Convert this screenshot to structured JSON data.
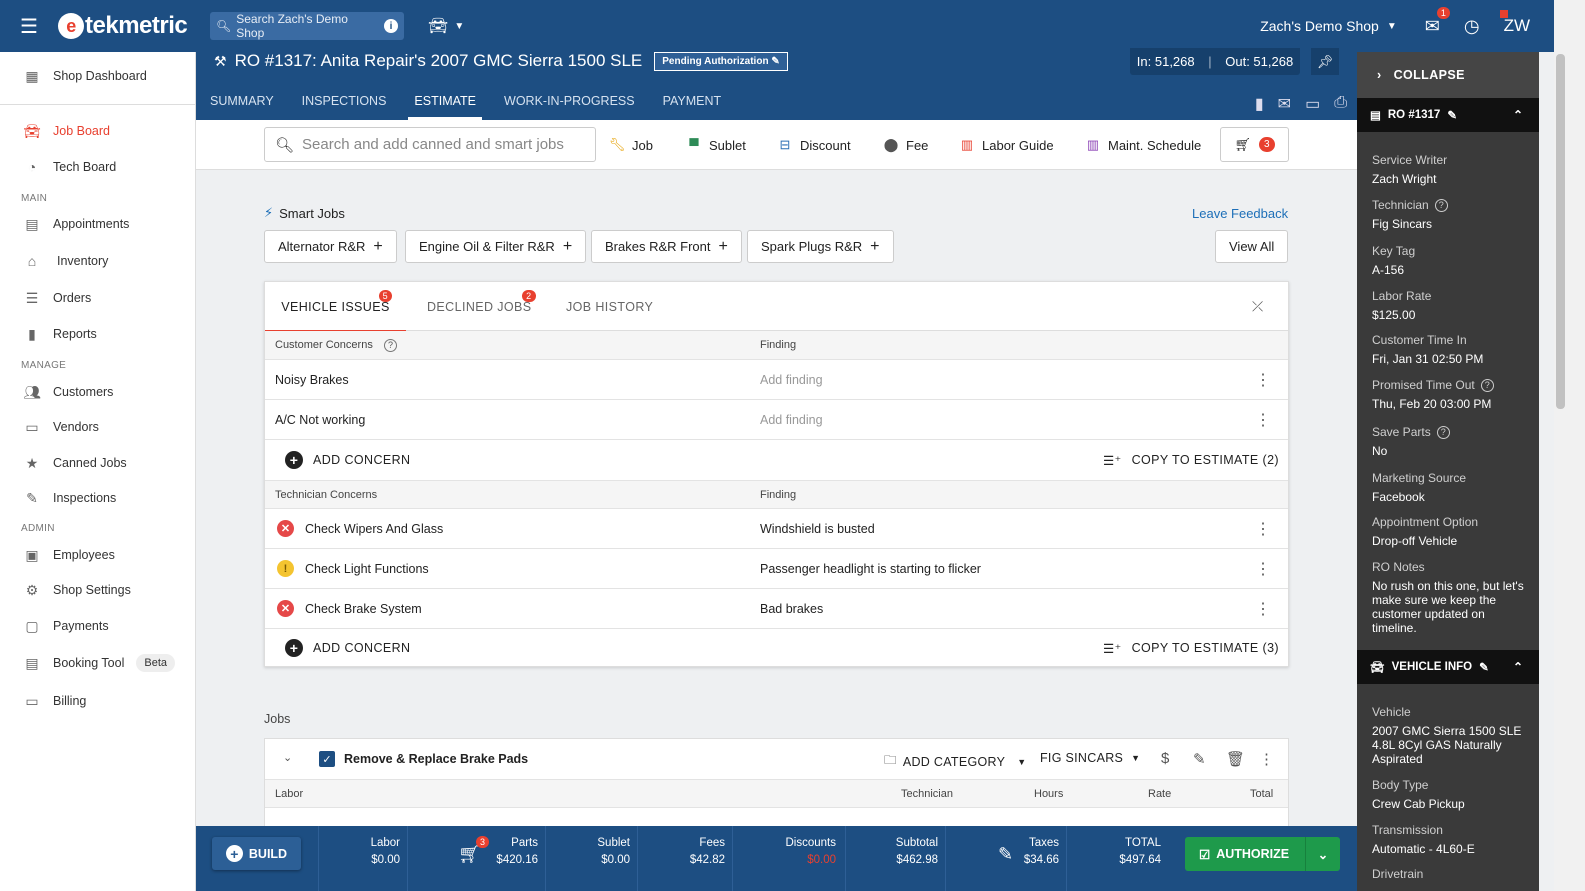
{
  "topbar": {
    "logo": "tekmetric",
    "logo_mark": "e",
    "search_placeholder": "Search Zach's Demo Shop",
    "shop_name": "Zach's Demo Shop",
    "messages_badge": "1",
    "user_initials": "ZW"
  },
  "sidebar": {
    "items": [
      {
        "label": "Shop Dashboard",
        "icon": "dashboard-icon"
      },
      {
        "label": "Job Board",
        "icon": "car-icon"
      },
      {
        "label": "Tech Board",
        "icon": "gauge-icon"
      },
      {
        "label": "Appointments",
        "icon": "calendar-icon"
      },
      {
        "label": "Inventory",
        "icon": "warehouse-icon"
      },
      {
        "label": "Orders",
        "icon": "list-icon"
      },
      {
        "label": "Reports",
        "icon": "bar-chart-icon"
      },
      {
        "label": "Customers",
        "icon": "people-icon"
      },
      {
        "label": "Vendors",
        "icon": "store-icon"
      },
      {
        "label": "Canned Jobs",
        "icon": "star-icon"
      },
      {
        "label": "Inspections",
        "icon": "clipboard-icon"
      },
      {
        "label": "Employees",
        "icon": "badge-icon"
      },
      {
        "label": "Shop Settings",
        "icon": "gear-icon"
      },
      {
        "label": "Payments",
        "icon": "payment-icon"
      },
      {
        "label": "Booking Tool",
        "icon": "booking-icon",
        "badge": "Beta"
      },
      {
        "label": "Billing",
        "icon": "credit-card-icon"
      }
    ],
    "sections": {
      "main": "MAIN",
      "manage": "MANAGE",
      "admin": "ADMIN"
    }
  },
  "ro": {
    "title": "RO #1317: Anita Repair's 2007 GMC Sierra 1500 SLE",
    "status": "Pending Authorization",
    "mileage_in": "In: 51,268",
    "mileage_out": "Out: 51,268",
    "tabs": [
      "SUMMARY",
      "INSPECTIONS",
      "ESTIMATE",
      "WORK-IN-PROGRESS",
      "PAYMENT"
    ]
  },
  "toolbar": {
    "search_placeholder": "Search and add canned and smart jobs",
    "buttons": [
      "Job",
      "Sublet",
      "Discount",
      "Fee",
      "Labor Guide",
      "Maint. Schedule"
    ],
    "cart_count": "3"
  },
  "smart_jobs": {
    "title": "Smart Jobs",
    "feedback": "Leave Feedback",
    "chips": [
      "Alternator R&R",
      "Engine Oil & Filter R&R",
      "Brakes R&R Front",
      "Spark Plugs R&R"
    ],
    "view_all": "View All"
  },
  "issues": {
    "tabs": [
      {
        "label": "VEHICLE ISSUES",
        "badge": "5"
      },
      {
        "label": "DECLINED JOBS",
        "badge": "2"
      },
      {
        "label": "JOB HISTORY",
        "badge": ""
      }
    ],
    "customer_header": "Customer Concerns",
    "finding_header": "Finding",
    "customer_rows": [
      {
        "concern": "Noisy Brakes",
        "finding": "Add finding"
      },
      {
        "concern": "A/C Not working",
        "finding": "Add finding"
      }
    ],
    "add_concern": "ADD CONCERN",
    "copy_customer": "COPY TO ESTIMATE (2)",
    "technician_header": "Technician Concerns",
    "technician_rows": [
      {
        "concern": "Check Wipers And Glass",
        "finding": "Windshield is busted",
        "status": "red"
      },
      {
        "concern": "Check Light Functions",
        "finding": "Passenger headlight is starting to flicker",
        "status": "yellow"
      },
      {
        "concern": "Check Brake System",
        "finding": "Bad brakes",
        "status": "red"
      }
    ],
    "copy_technician": "COPY TO ESTIMATE (3)"
  },
  "jobs": {
    "label": "Jobs",
    "job_title": "Remove & Replace Brake Pads",
    "add_category": "ADD CATEGORY",
    "technician": "FIG SINCARS",
    "columns": [
      "Labor",
      "Technician",
      "Hours",
      "Rate",
      "Total"
    ]
  },
  "right_panel": {
    "collapse": "COLLAPSE",
    "ro_section": "RO #1317",
    "fields": [
      {
        "k": "Service Writer",
        "v": "Zach Wright"
      },
      {
        "k": "Technician",
        "v": "Fig Sincars",
        "help": true
      },
      {
        "k": "Key Tag",
        "v": "A-156"
      },
      {
        "k": "Labor Rate",
        "v": "$125.00"
      },
      {
        "k": "Customer Time In",
        "v": "Fri, Jan 31 02:50 PM"
      },
      {
        "k": "Promised Time Out",
        "v": "Thu, Feb 20 03:00 PM",
        "help": true
      },
      {
        "k": "Save Parts",
        "v": "No",
        "help": true
      },
      {
        "k": "Marketing Source",
        "v": "Facebook"
      },
      {
        "k": "Appointment Option",
        "v": "Drop-off Vehicle"
      },
      {
        "k": "RO Notes",
        "v": "No rush on this one, but let's make sure we keep the customer updated on timeline."
      }
    ],
    "vehicle_section": "VEHICLE INFO",
    "vehicle_fields": [
      {
        "k": "Vehicle",
        "v": "2007 GMC Sierra 1500 SLE 4.8L 8Cyl GAS Naturally Aspirated"
      },
      {
        "k": "Body Type",
        "v": "Crew Cab Pickup"
      },
      {
        "k": "Transmission",
        "v": "Automatic - 4L60-E"
      },
      {
        "k": "Drivetrain",
        "v": ""
      }
    ]
  },
  "totals": {
    "build": "BUILD",
    "parts_badge": "3",
    "items": [
      {
        "label": "Labor",
        "value": "$0.00"
      },
      {
        "label": "Parts",
        "value": "$420.16"
      },
      {
        "label": "Sublet",
        "value": "$0.00"
      },
      {
        "label": "Fees",
        "value": "$42.82"
      },
      {
        "label": "Discounts",
        "value": "$0.00"
      },
      {
        "label": "Subtotal",
        "value": "$462.98"
      },
      {
        "label": "Taxes",
        "value": "$34.66"
      },
      {
        "label": "TOTAL",
        "value": "$497.64"
      }
    ],
    "authorize": "AUTHORIZE"
  },
  "colors": {
    "brand": "#1d4e82",
    "accent": "#e8402f",
    "success": "#1e9a4b"
  }
}
